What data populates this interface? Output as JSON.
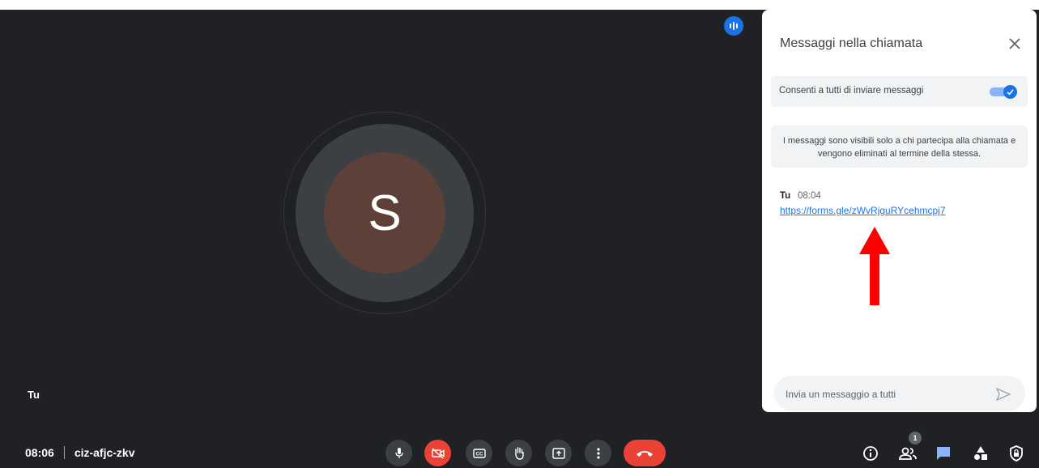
{
  "participant": {
    "initial": "S",
    "name_label": "Tu",
    "avatar_color": "#5d4037"
  },
  "chat_panel": {
    "title": "Messaggi nella chiamata",
    "allow_label": "Consenti a tutti di inviare messaggi",
    "allow_enabled": true,
    "info_text": "I messaggi sono visibili solo a chi partecipa alla chiamata e vengono eliminati al termine della stessa.",
    "messages": [
      {
        "sender": "Tu",
        "time": "08:04",
        "text": "https://forms.gle/zWvRjguRYcehmcpj7"
      }
    ],
    "input_placeholder": "Invia un messaggio a tutti"
  },
  "meeting": {
    "time": "08:06",
    "code": "ciz-afjc-zkv"
  },
  "controls": {
    "mic": "mic-icon",
    "camera": "camera-off-icon",
    "captions": "captions-icon",
    "raise_hand": "hand-icon",
    "present": "present-icon",
    "more": "more-vert-icon",
    "end_call": "phone-hangup-icon"
  },
  "side_controls": {
    "participants_count": "1"
  },
  "colors": {
    "background": "#202124",
    "accent": "#1a73e8",
    "danger": "#ea4335",
    "annotation_arrow": "#ff0000"
  }
}
